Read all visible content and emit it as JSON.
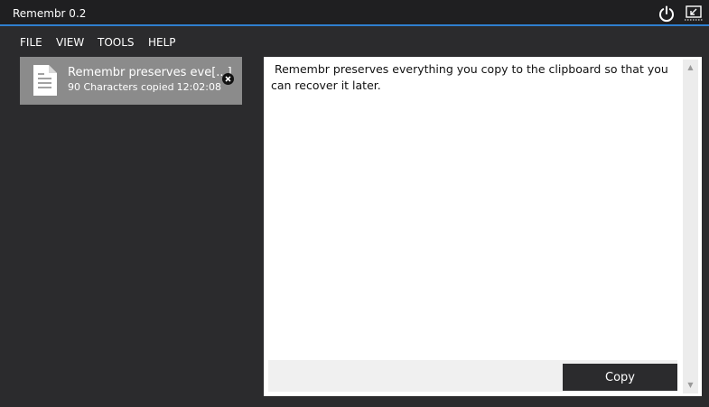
{
  "app": {
    "title": "Remembr 0.2"
  },
  "titlebar": {
    "icons": [
      "power-icon",
      "minimize-to-tray-icon"
    ]
  },
  "menu": {
    "file": "FILE",
    "view": "VIEW",
    "tools": "TOOLS",
    "help": "HELP"
  },
  "clips": [
    {
      "title": "Remembr preserves eve[...]",
      "chars": "90 Characters copied",
      "time": "12:02:08",
      "icon": "document-icon"
    }
  ],
  "detail": {
    "text": " Remembr preserves everything you copy to the clipboard so that you can recover it later.",
    "copy_label": "Copy"
  },
  "colors": {
    "background": "#2b2b2d",
    "titlebar": "#1f1f21",
    "accent": "#2f7fd0",
    "selected_item": "#8b8b8b",
    "button": "#2b2b2d"
  }
}
